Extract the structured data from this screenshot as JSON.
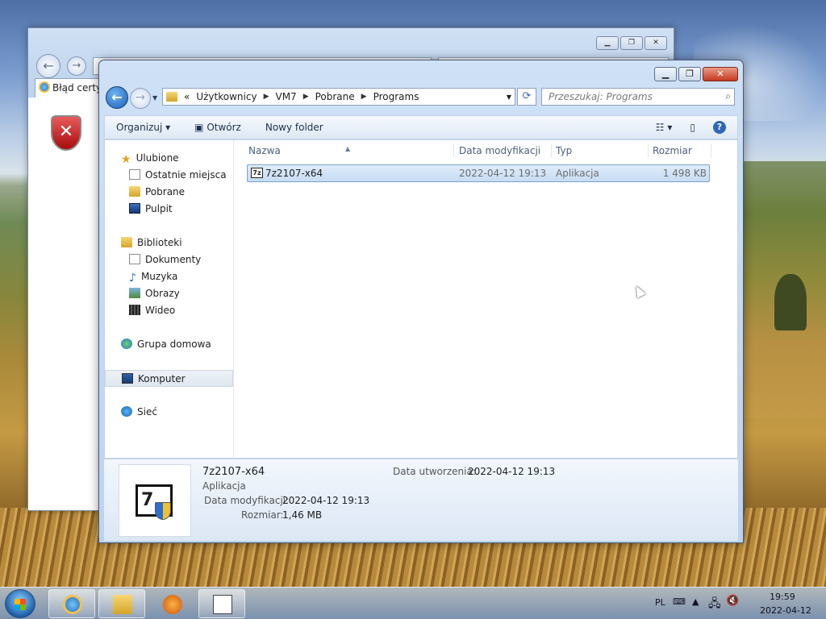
{
  "ie_window": {
    "tab_label": "Błąd certy"
  },
  "explorer": {
    "address_path": [
      "Użytkownicy",
      "VM7",
      "Pobrane",
      "Programs"
    ],
    "address_prefix": "«",
    "search_placeholder": "Przeszukaj: Programs",
    "toolbar": {
      "organize_label": "Organizuj ▾",
      "open_label": "Otwórz",
      "new_folder_label": "Nowy folder"
    },
    "nav": {
      "favorites": "Ulubione",
      "recent": "Ostatnie miejsca",
      "downloads": "Pobrane",
      "desktop": "Pulpit",
      "libraries": "Biblioteki",
      "documents": "Dokumenty",
      "music": "Muzyka",
      "pictures": "Obrazy",
      "videos": "Wideo",
      "homegroup": "Grupa domowa",
      "computer": "Komputer",
      "network": "Sieć"
    },
    "columns": {
      "name": "Nazwa",
      "modified": "Data modyfikacji",
      "type": "Typ",
      "size": "Rozmiar"
    },
    "files": [
      {
        "name": "7z2107-x64",
        "modified": "2022-04-12 19:13",
        "type": "Aplikacja",
        "size": "1 498 KB"
      }
    ],
    "details": {
      "name": "7z2107-x64",
      "type": "Aplikacja",
      "modified_label": "Data modyfikacji:",
      "modified_value": "2022-04-12 19:13",
      "size_label": "Rozmiar:",
      "size_value": "1,46 MB",
      "created_label": "Data utworzenia:",
      "created_value": "2022-04-12 19:13"
    }
  },
  "taskbar": {
    "language": "PL",
    "time": "19:59",
    "date": "2022-04-12"
  },
  "colors": {
    "accent": "#2e66b8",
    "selection": "#c7dcf4"
  }
}
